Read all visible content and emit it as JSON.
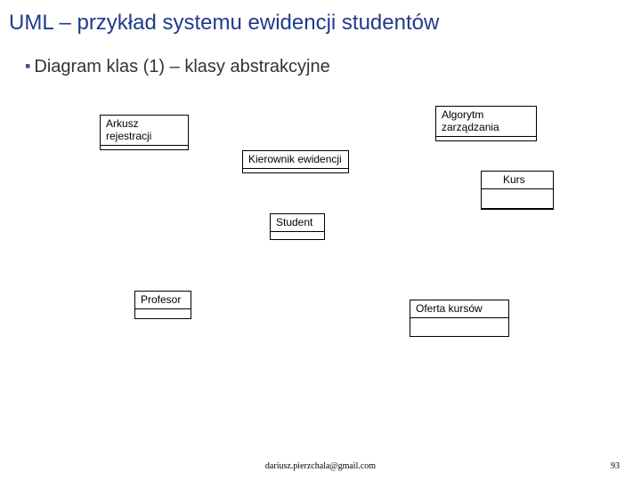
{
  "title": "UML – przykład systemu ewidencji studentów",
  "subtitle": "Diagram klas (1) – klasy abstrakcyjne",
  "classes": {
    "arkusz": "Arkusz rejestracji",
    "algorytm": "Algorytm zarządzania",
    "kierownik": "Kierownik ewidencji",
    "kurs": "Kurs",
    "student": "Student",
    "profesor": "Profesor",
    "oferta": "Oferta kursów"
  },
  "footer": {
    "email": "dariusz.pierzchala@gmail.com",
    "page": "93"
  }
}
